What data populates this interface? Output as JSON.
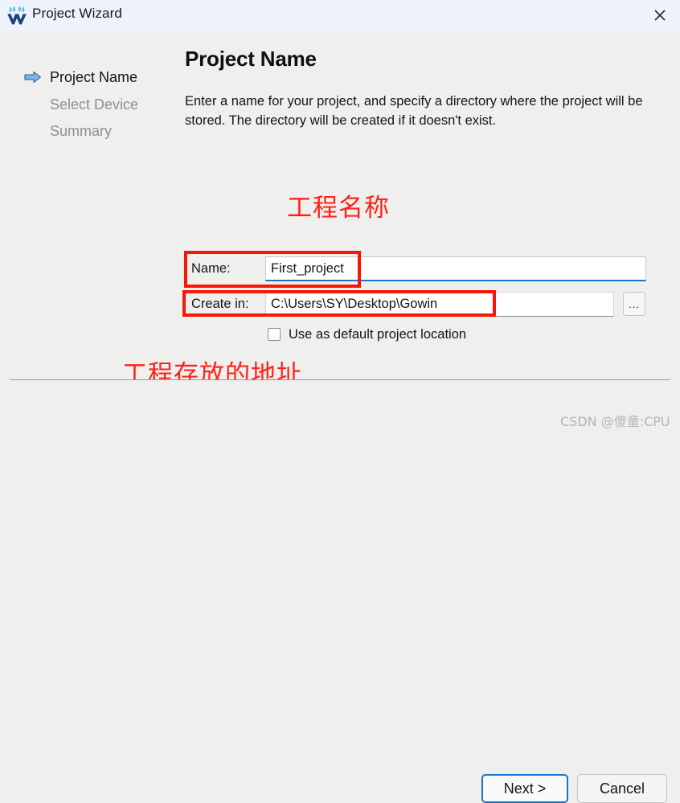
{
  "window": {
    "title": "Project Wizard",
    "logo_icon": "gowin-w-logo-icon",
    "close_icon": "close-icon"
  },
  "sidebar": {
    "steps": [
      {
        "label": "Project Name",
        "state": "active",
        "icon": "blue-arrow-right-icon"
      },
      {
        "label": "Select Device",
        "state": "inactive",
        "icon": ""
      },
      {
        "label": "Summary",
        "state": "inactive",
        "icon": ""
      }
    ]
  },
  "main": {
    "title": "Project Name",
    "description": "Enter a name for your project, and specify a directory where the project will be stored. The directory will be created if it doesn't exist."
  },
  "form": {
    "name_label": "Name:",
    "name_value": "First_project",
    "dir_label": "Create in:",
    "dir_value": "C:\\Users\\SY\\Desktop\\Gowin",
    "browse_label": "...",
    "default_location_label": "Use as default project location",
    "default_location_checked": false
  },
  "annotations": {
    "name_note": "工程名称",
    "dir_note": "工程存放的地址",
    "color": "#ff2116"
  },
  "footer": {
    "next_label": "Next >",
    "cancel_label": "Cancel"
  },
  "watermark": {
    "text": "CSDN @傻童:CPU"
  },
  "colors": {
    "titlebar_bg": "#eef2fb",
    "body_bg": "#efefee",
    "accent_blue": "#1a73c8",
    "annotation_red": "#fa1505",
    "inactive_step": "#8f8f8f"
  }
}
